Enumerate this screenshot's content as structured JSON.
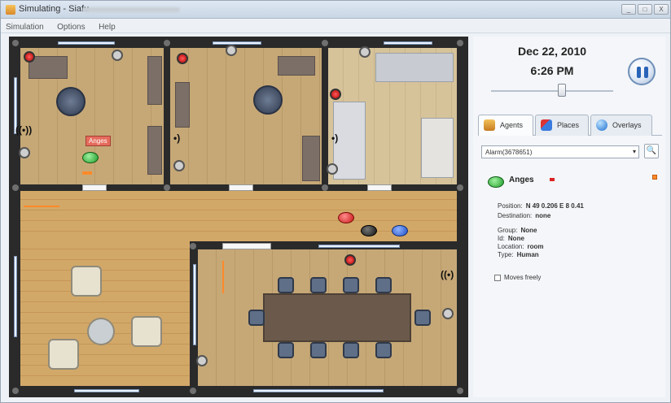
{
  "window": {
    "title": "Simulating - Siafu"
  },
  "menu": {
    "items": [
      "Simulation",
      "Options",
      "Help"
    ]
  },
  "window_controls": {
    "minimize": "_",
    "maximize": "□",
    "close": "X"
  },
  "map": {
    "agent_tag": "Anges"
  },
  "panel": {
    "date": "Dec 22, 2010",
    "time": "6:26 PM",
    "tabs": {
      "agents": "Agents",
      "places": "Places",
      "overlays": "Overlays"
    },
    "selector": {
      "value": "Alarm(3678651)",
      "arrow": "▾",
      "search_glyph": "🔍"
    },
    "agent": {
      "name": "Anges",
      "properties": {
        "position": "N 49 0.206 E 8 0.41",
        "destination": "none",
        "group": "None",
        "id": "None",
        "location": "room",
        "type": "Human"
      },
      "labels": {
        "position": "Position:",
        "destination": "Destination:",
        "group": "Group:",
        "id": "Id:",
        "location": "Location:",
        "type": "Type:"
      },
      "moves_freely": "Moves freely"
    }
  },
  "icons": {
    "app": "app-icon",
    "pause": "pause-icon",
    "agents_tab": "agents-icon",
    "places_tab": "places-icon",
    "overlays_tab": "overlays-icon",
    "search": "search-icon"
  },
  "colors": {
    "accent": "#2a64b8",
    "alarm": "#c81414",
    "agent_green": "#1e9b2a",
    "agent_blue": "#1f4fc2"
  }
}
